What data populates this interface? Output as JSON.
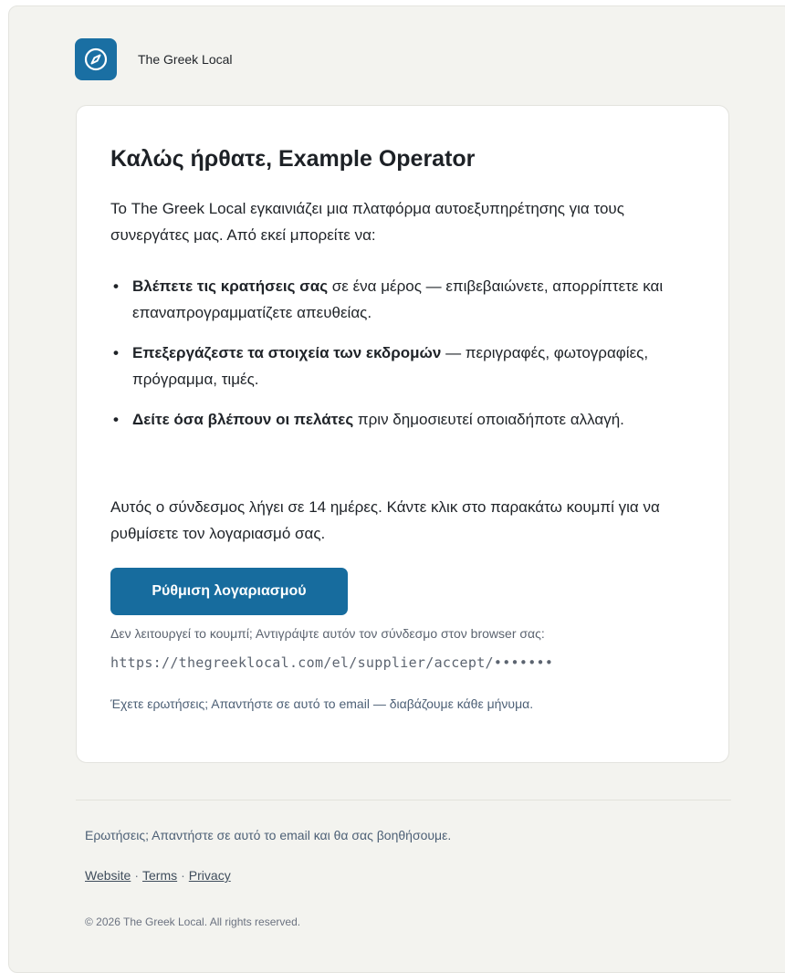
{
  "brand": {
    "name": "The Greek Local",
    "logo_icon": "compass-icon",
    "accent_color": "#176c9e"
  },
  "card": {
    "title": "Καλώς ήρθατε, Example Operator",
    "intro": "Το The Greek Local εγκαινιάζει μια πλατφόρμα αυτοεξυπηρέτησης για τους συνεργάτες μας. Από εκεί μπορείτε να:",
    "features": [
      {
        "bold": "Βλέπετε τις κρατήσεις σας",
        "text": " σε ένα μέρος — επιβεβαιώνετε, απορρίπτετε και επαναπρογραμματίζετε απευθείας."
      },
      {
        "bold": "Επεξεργάζεστε τα στοιχεία των εκδρομών",
        "text": " — περιγραφές, φωτογραφίες, πρόγραμμα, τιμές."
      },
      {
        "bold": "Δείτε όσα βλέπουν οι πελάτες",
        "text": " πριν δημοσιευτεί οποιαδήποτε αλλαγή."
      }
    ],
    "expiry_note": "Αυτός ο σύνδεσμος λήγει σε 14 ημέρες. Κάντε κλικ στο παρακάτω κουμπί για να ρυθμίσετε τον λογαριασμό σας.",
    "cta_label": "Ρύθμιση λογαριασμού",
    "fallback_text": "Δεν λειτουργεί το κουμπί; Αντιγράψτε αυτόν τον σύνδεσμο στον browser σας:",
    "fallback_link": "https://thegreeklocal.com/el/supplier/accept/•••••••",
    "questions_text": "Έχετε ερωτήσεις; Απαντήστε σε αυτό το email — διαβάζουμε κάθε μήνυμα."
  },
  "footer": {
    "questions_text": "Ερωτήσεις; Απαντήστε σε αυτό το email και θα σας βοηθήσουμε.",
    "links": [
      "Website",
      "Terms",
      "Privacy"
    ],
    "separator": "·",
    "copyright": "© 2026 The Greek Local. All rights reserved."
  }
}
